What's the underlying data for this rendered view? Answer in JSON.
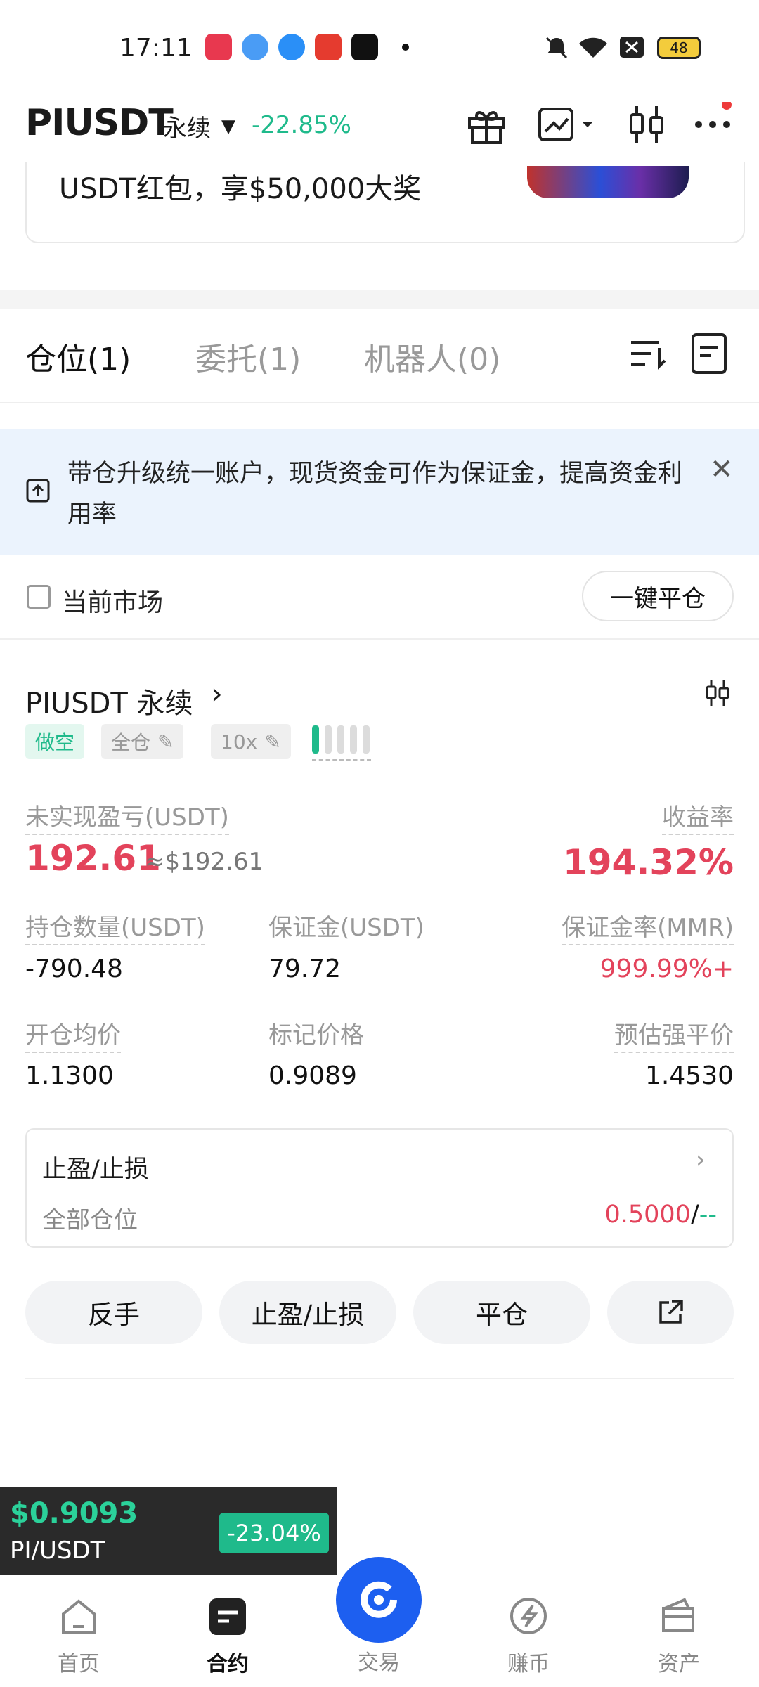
{
  "status_bar": {
    "time": "17:11",
    "battery": "48"
  },
  "header": {
    "symbol": "PIUSDT",
    "contract_type": "永续",
    "change": "-22.85%"
  },
  "promo_banner": {
    "text": "USDT红包，享$50,000大奖"
  },
  "tabs": [
    {
      "label": "仓位(1)"
    },
    {
      "label": "委托(1)"
    },
    {
      "label": "机器人(0)"
    }
  ],
  "info_banner": {
    "text": "带仓升级统一账户，现货资金可作为保证金，提高资金利用率"
  },
  "filter": {
    "current_market_label": "当前市场",
    "close_all_label": "一键平仓"
  },
  "position": {
    "title": "PIUSDT 永续",
    "side_tag": "做空",
    "margin_mode": "全仓",
    "leverage": "10x",
    "unrealized_pnl_label": "未实现盈亏(USDT)",
    "unrealized_pnl": "192.61",
    "unrealized_pnl_usd": "≈$192.61",
    "roe_label": "收益率",
    "roe": "194.32%",
    "size_label": "持仓数量(USDT)",
    "size": "-790.48",
    "margin_label": "保证金(USDT)",
    "margin": "79.72",
    "mmr_label": "保证金率(MMR)",
    "mmr": "999.99%+",
    "entry_label": "开仓均价",
    "entry": "1.1300",
    "mark_label": "标记价格",
    "mark": "0.9089",
    "liq_label": "预估强平价",
    "liq": "1.4530"
  },
  "tpsl": {
    "title": "止盈/止损",
    "scope": "全部仓位",
    "tp_value": "0.5000",
    "sl_value": "--"
  },
  "actions": {
    "reverse": "反手",
    "tpsl": "止盈/止损",
    "close": "平仓"
  },
  "ticker": {
    "price": "$0.9093",
    "pair": "PI/USDT",
    "change": "-23.04%"
  },
  "nav": [
    {
      "label": "首页",
      "icon": "home-icon"
    },
    {
      "label": "合约",
      "icon": "contract-icon"
    },
    {
      "label": "交易",
      "icon": "trade-icon"
    },
    {
      "label": "赚币",
      "icon": "earn-icon"
    },
    {
      "label": "资产",
      "icon": "wallet-icon"
    }
  ],
  "colors": {
    "green": "#1fba8b",
    "red": "#e3435b",
    "accent": "#1d5ff0"
  }
}
